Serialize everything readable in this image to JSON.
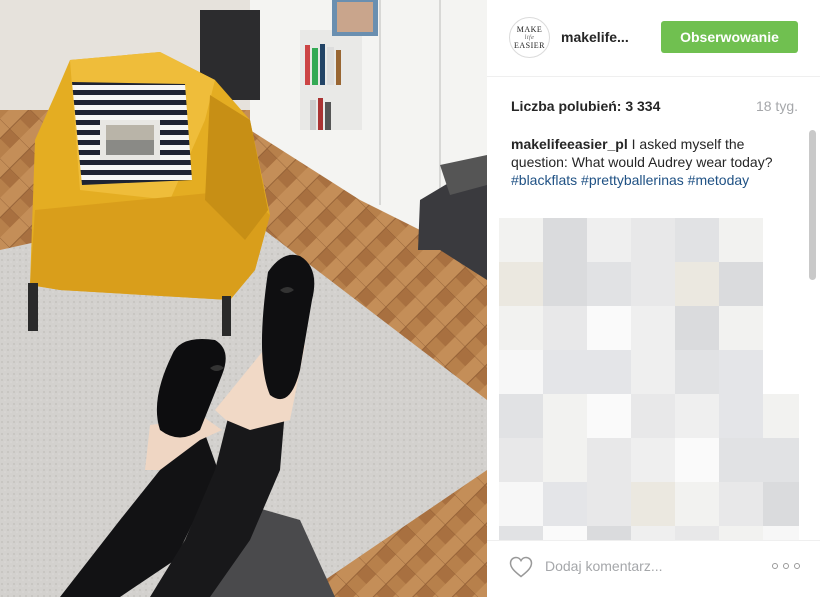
{
  "post": {
    "author": {
      "avatar_line1": "MAKE",
      "avatar_line2": "life",
      "avatar_line3": "EASIER",
      "username": "makelife..."
    },
    "follow_label": "Obserwowanie",
    "likes_text": "Liczba polubień: 3 334",
    "age_text": "18 tyg.",
    "caption": {
      "username": "makelifeeasier_pl",
      "text": " I asked myself the question: What would Audrey wear today? ",
      "hashtags": [
        "#blackflats",
        "#prettyballerinas",
        "#metoday"
      ]
    },
    "comment_placeholder": "Dodaj komentarz...",
    "colors": {
      "follow_button": "#70c050",
      "hashtag": "#1f5184",
      "muted_text": "#a5a7aa",
      "armchair": "#e8b52a",
      "floor": "#b9804a",
      "rug": "#cfcdcb"
    },
    "icons": {
      "like": "heart-outline-icon",
      "more": "more-options-icon"
    }
  }
}
